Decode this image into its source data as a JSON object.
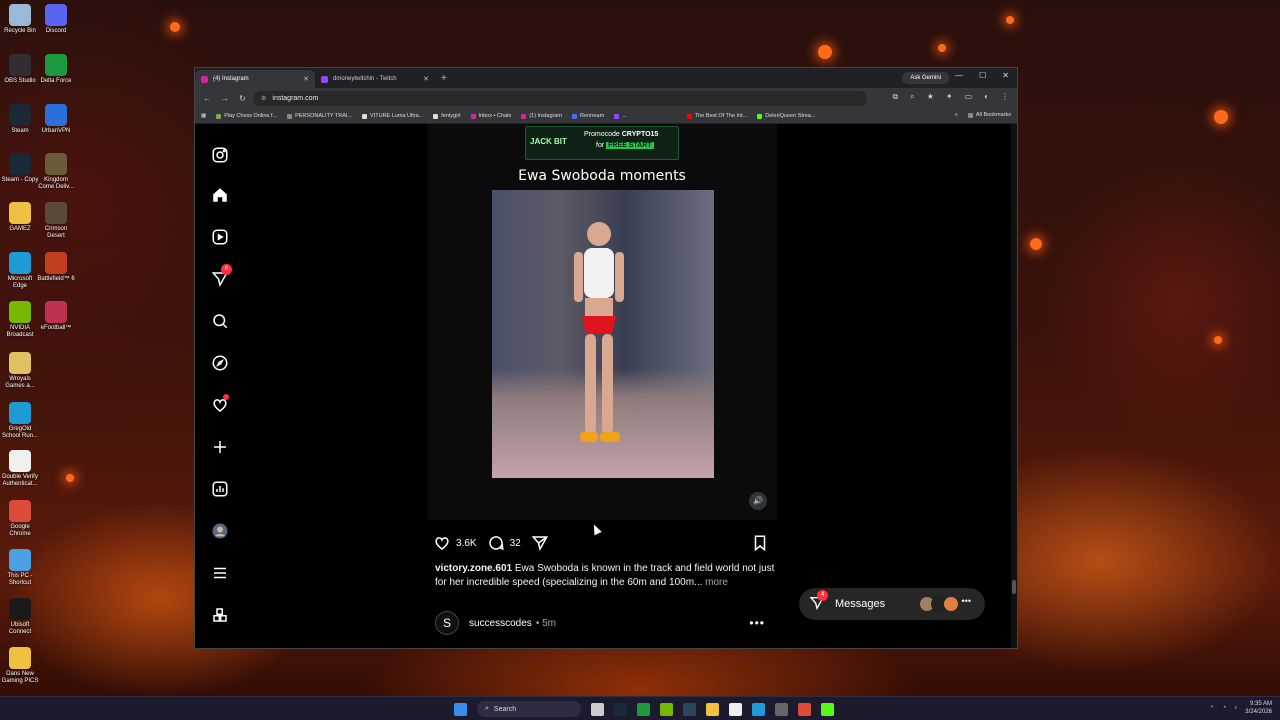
{
  "desktop": {
    "icons": [
      {
        "label": "Recycle Bin",
        "color": "#9bb8d8"
      },
      {
        "label": "Discord",
        "color": "#5865f2"
      },
      {
        "label": "OBS Studio",
        "color": "#302e31"
      },
      {
        "label": "Delta Force",
        "color": "#1c9a3f"
      },
      {
        "label": "Steam",
        "color": "#1b2838"
      },
      {
        "label": "UrbanVPN",
        "color": "#2c6fd8"
      },
      {
        "label": "Steam - Copy",
        "color": "#1b2838"
      },
      {
        "label": "Kingdom Come Deliv...",
        "color": "#6b5a3a"
      },
      {
        "label": "GAMEZ",
        "color": "#f0c040"
      },
      {
        "label": "Crimson Desert",
        "color": "#5a4a3a"
      },
      {
        "label": "Microsoft Edge",
        "color": "#1e9bd7"
      },
      {
        "label": "Battlefield™ 6",
        "color": "#c04020"
      },
      {
        "label": "NVIDIA Broadcast",
        "color": "#76b900"
      },
      {
        "label": "eFootball™",
        "color": "#c03050"
      },
      {
        "label": "Wroyals Games a...",
        "color": "#e0c060"
      },
      {
        "label": "GregOld School Run...",
        "color": "#1e9bd7"
      },
      {
        "label": "Double Verify Authenticat...",
        "color": "#f0f0f0"
      },
      {
        "label": "Google Chrome",
        "color": "#dd4b39"
      },
      {
        "label": "This PC - Shortcut",
        "color": "#4aa0e0"
      },
      {
        "label": "Ubisoft Connect",
        "color": "#1a1a1a"
      },
      {
        "label": "Dans New Gaming PICS",
        "color": "#f0c040"
      }
    ]
  },
  "browser": {
    "tabs": [
      {
        "label": "(4) Instagram",
        "active": true
      },
      {
        "label": "dmoneytwitchin - Twitch",
        "active": false
      }
    ],
    "new_tab": "+",
    "ask_gemini": "Ask Gemini",
    "url": "instagram.com",
    "bookmarks": [
      {
        "label": "Play Chess Online f...",
        "color": "#7fa650"
      },
      {
        "label": "PERSONALITY TRAI...",
        "color": "#888888"
      },
      {
        "label": "VITURE Luma Ultra...",
        "color": "#dddddd"
      },
      {
        "label": "fentygirl",
        "color": "#dddddd"
      },
      {
        "label": "Inbox • Chats",
        "color": "#d6249f"
      },
      {
        "label": "(1) Instagram",
        "color": "#d6249f"
      },
      {
        "label": "Rentream",
        "color": "#4a6cf7"
      },
      {
        "label": "...",
        "color": "#9146ff"
      },
      {
        "label": "The Best Of The Int...",
        "color": "#ff0000"
      },
      {
        "label": "DeleriQueen Strea...",
        "color": "#53fc18"
      }
    ],
    "all_bookmarks": "All Bookmarks"
  },
  "instagram": {
    "notifications_badge": "6",
    "promo": {
      "brand": "JACK BIT",
      "promocode_label": "Promocode",
      "promocode": "CRYPTO15",
      "for": "for",
      "free_start": "FREE START"
    },
    "video_title": "Ewa Swoboda moments",
    "likes": "3.6K",
    "comments": "32",
    "caption_user": "victory.zone.601",
    "caption_text": "Ewa Swoboda is known in the track and field world not just for her incredible speed (specializing in the 60m and 100m...",
    "caption_more": "more",
    "next_post": {
      "avatar_letter": "S",
      "username": "successcodes",
      "time": "• 5m"
    },
    "messages": {
      "label": "Messages",
      "badge": "4",
      "avatar_colors": [
        "#a08060",
        "#222222",
        "#e08040"
      ]
    }
  },
  "taskbar": {
    "search": "Search",
    "time": "9:35 AM",
    "date": "3/24/2026"
  }
}
